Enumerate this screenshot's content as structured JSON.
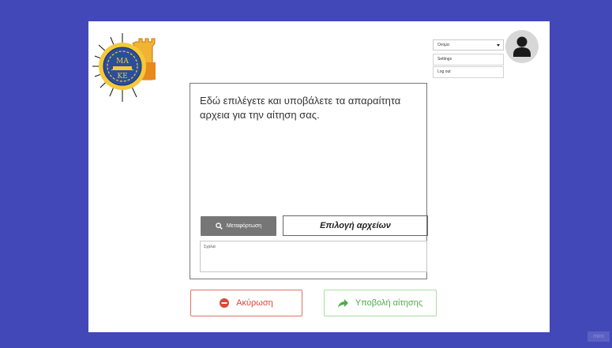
{
  "logo": {
    "text": "ΜΑΚΕ",
    "icon": "university-seal-logo"
  },
  "user_menu": {
    "name": "Ονομα",
    "items": [
      {
        "label": "Settings"
      },
      {
        "label": "Log out"
      }
    ]
  },
  "panel": {
    "intro": "Εδώ επιλέγετε και υποβάλετε τα απαραίτητα αρχεια για την αίτηση σας.",
    "upload_label": "Μεταφόρτωση",
    "choose_files_label": "Επιλογή αρχείων",
    "comments_placeholder": "Σχόλια"
  },
  "actions": {
    "cancel_label": "Ακύρωση",
    "submit_label": "Υποβολή αίτησης"
  },
  "watermark": "miro",
  "colors": {
    "background": "#4248b7",
    "cancel": "#d9483b",
    "submit": "#53a84f",
    "upload_button": "#767676"
  }
}
